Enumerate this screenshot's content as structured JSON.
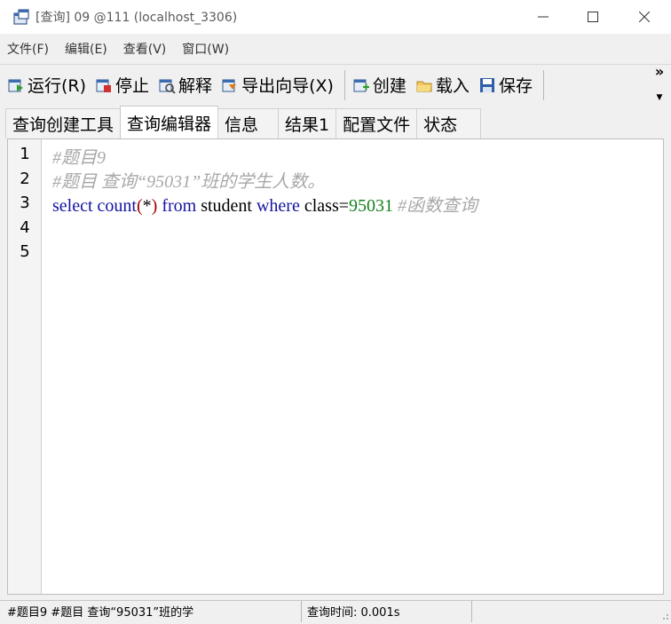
{
  "window": {
    "title": "[查询] 09 @111 (localhost_3306)"
  },
  "menu": [
    "文件(F)",
    "编辑(E)",
    "查看(V)",
    "窗口(W)"
  ],
  "toolbar": {
    "run": "运行(R)",
    "stop": "停止",
    "explain": "解释",
    "export_wizard": "导出向导(X)",
    "create": "创建",
    "load": "载入",
    "save": "保存",
    "overflow": "»"
  },
  "tabs": [
    "查询创建工具",
    "查询编辑器",
    "信息",
    "结果1",
    "配置文件",
    "状态"
  ],
  "active_tab": "查询编辑器",
  "editor": {
    "line_numbers": [
      "1",
      "2",
      "3",
      "4",
      "5"
    ],
    "line1": "#题目9",
    "line2": "#题目 查询“95031”班的学生人数。",
    "line3": {
      "select": "select",
      "count": "count",
      "paren_open": "(",
      "star": "*",
      "paren_close": ")",
      "from": "from",
      "table": "student",
      "where": "where",
      "column": "class=",
      "value": "95031",
      "comment": "#函数查询"
    }
  },
  "status": {
    "left": "#题目9 #题目 查询“95031”班的学",
    "query_time": "查询时间: 0.001s"
  },
  "colors": {
    "keyword": "#1414a0",
    "number": "#14821e",
    "comment": "#a8a8a8",
    "operator": "#a00000"
  }
}
